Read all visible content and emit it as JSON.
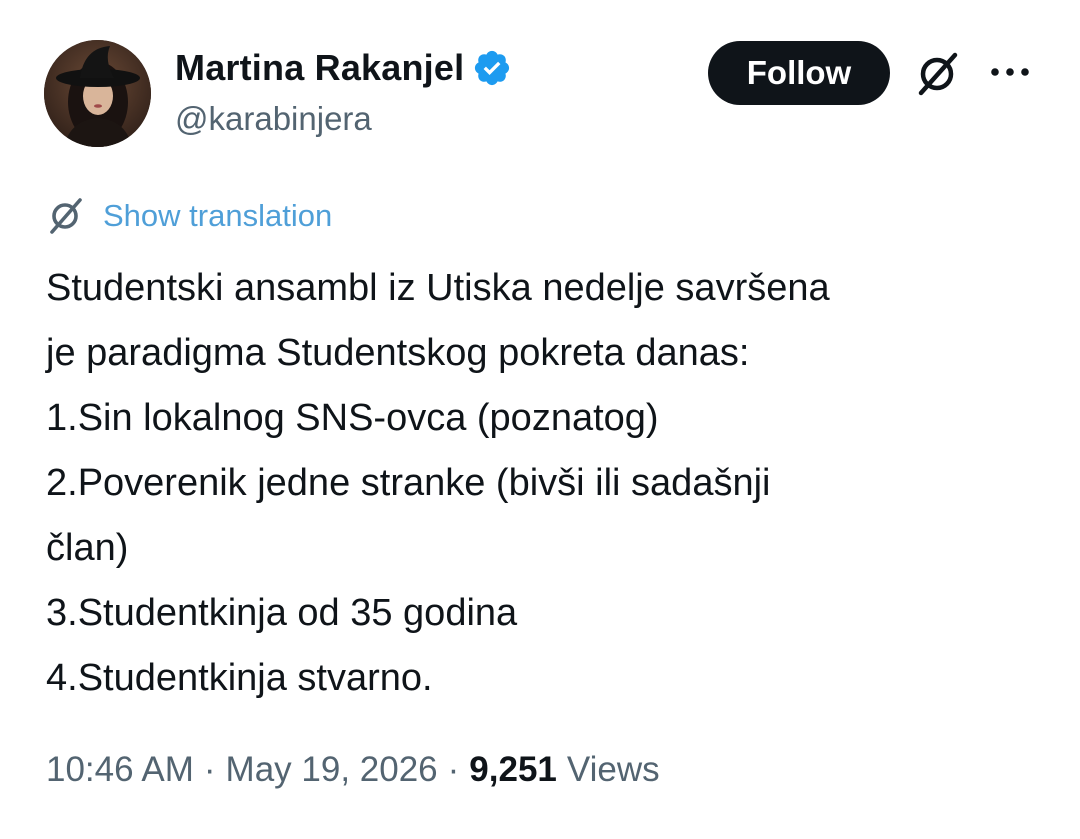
{
  "author": {
    "name": "Martina Rakanjel",
    "handle": "@karabinjera",
    "verified": true,
    "verified_color": "#1d9bf0"
  },
  "actions": {
    "follow_label": "Follow",
    "grok_icon": "grok-icon",
    "more_icon": "more-icon"
  },
  "translation": {
    "icon": "grok-icon",
    "label": "Show translation",
    "color": "#4f9fd8"
  },
  "tweet": {
    "lines": [
      "Studentski ansambl iz Utiska nedelje savršena",
      "je paradigma Studentskog pokreta danas:",
      "1.Sin lokalnog SNS-ovca (poznatog)",
      "2.Poverenik jedne stranke (bivši ili sadašnji",
      "član)",
      "3.Studentkinja od 35 godina",
      "4.Studentkinja stvarno."
    ]
  },
  "meta": {
    "time": "10:46 AM",
    "separator": "·",
    "date": "May 19, 2026",
    "views_count": "9,251",
    "views_label": "Views"
  }
}
